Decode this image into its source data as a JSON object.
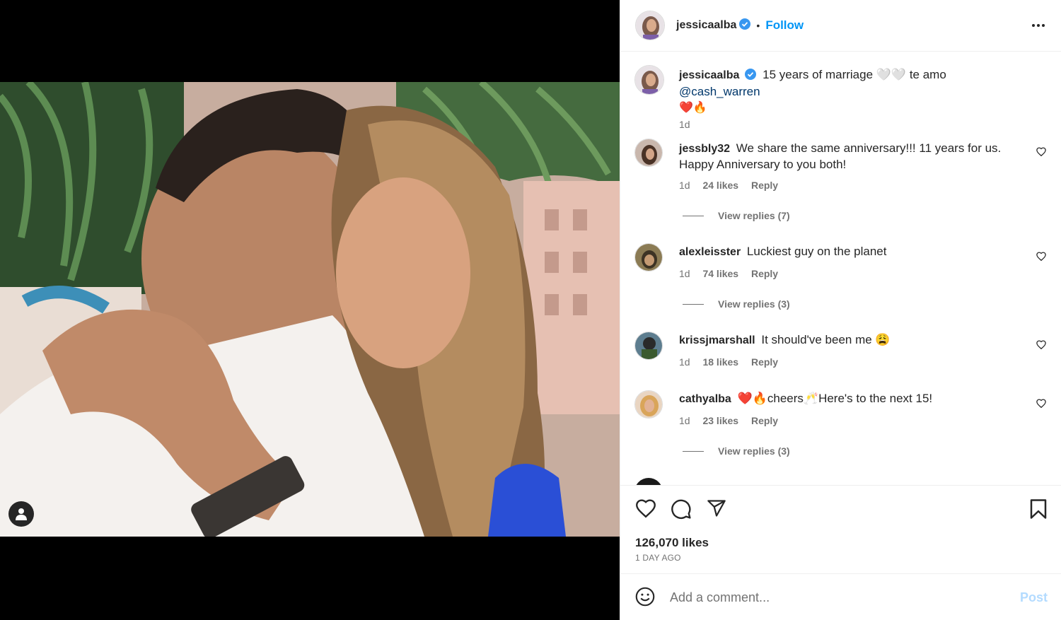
{
  "post": {
    "username": "jessicaalba",
    "follow_label": "Follow",
    "dot": "•",
    "caption_text": "15 years of marriage 🤍🤍 te amo",
    "caption_mention": "@cash_warren",
    "caption_emojis": "❤️🔥",
    "caption_time": "1d",
    "likes": "126,070 likes",
    "date": "1 DAY AGO"
  },
  "comments": [
    {
      "username": "jessbly32",
      "text": "We share the same anniversary!!! 11 years for us. Happy Anniversary to you both!",
      "time": "1d",
      "likes": "24 likes",
      "reply_label": "Reply",
      "view_replies": "View replies (7)"
    },
    {
      "username": "alexleisster",
      "text": "Luckiest guy on the planet",
      "time": "1d",
      "likes": "74 likes",
      "reply_label": "Reply",
      "view_replies": "View replies (3)"
    },
    {
      "username": "krissjmarshall",
      "text": "It should've been me 😩",
      "time": "1d",
      "likes": "18 likes",
      "reply_label": "Reply",
      "view_replies": ""
    },
    {
      "username": "cathyalba",
      "text": "❤️🔥cheers🥂Here's to the next 15!",
      "time": "1d",
      "likes": "23 likes",
      "reply_label": "Reply",
      "view_replies": "View replies (3)"
    }
  ],
  "add_comment": {
    "placeholder": "Add a comment...",
    "post_label": "Post"
  },
  "colors": {
    "accent": "#0095f6",
    "verified": "#3897f0",
    "post_disabled": "#b3dbff"
  },
  "icons": [
    "verified-badge-icon",
    "more-options-icon",
    "heart-icon",
    "comment-icon",
    "share-icon",
    "bookmark-icon",
    "emoji-icon",
    "user-tag-icon"
  ]
}
